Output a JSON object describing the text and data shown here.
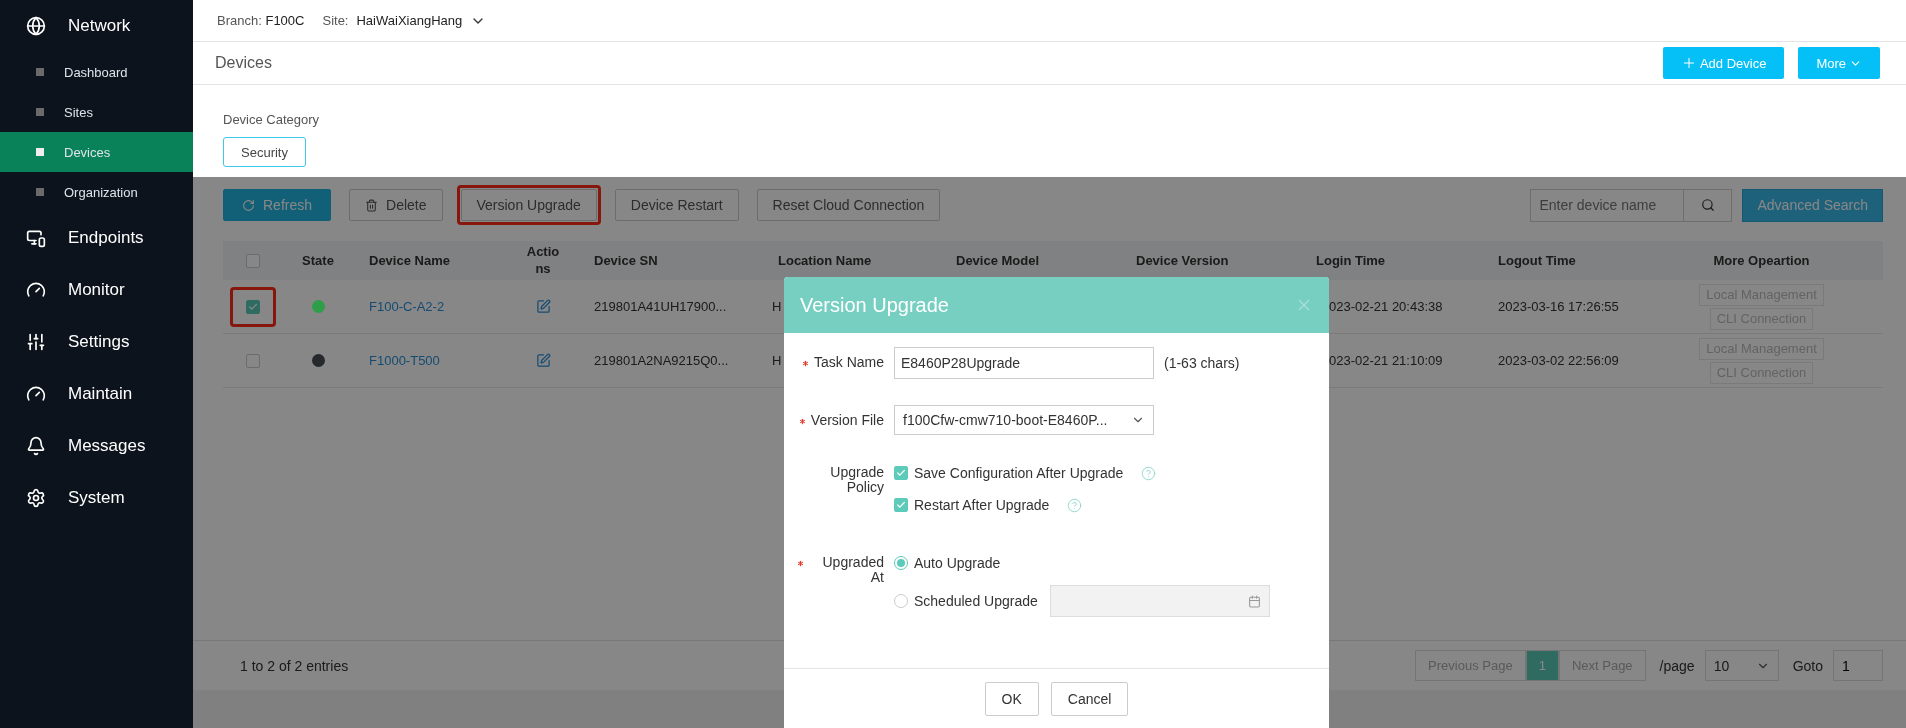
{
  "sidebar": {
    "items": [
      {
        "label": "Network",
        "kind": "network",
        "children": [
          {
            "label": "Dashboard",
            "selected": false
          },
          {
            "label": "Sites",
            "selected": false
          },
          {
            "label": "Devices",
            "selected": true
          },
          {
            "label": "Organization",
            "selected": false
          }
        ]
      },
      {
        "label": "Endpoints",
        "kind": "endpoints"
      },
      {
        "label": "Monitor",
        "kind": "gauge"
      },
      {
        "label": "Settings",
        "kind": "sliders"
      },
      {
        "label": "Maintain",
        "kind": "gauge"
      },
      {
        "label": "Messages",
        "kind": "bell"
      },
      {
        "label": "System",
        "kind": "gear"
      }
    ]
  },
  "top_bar": {
    "branch_label": "Branch:",
    "branch": "F100C",
    "site_label": "Site:",
    "site": "HaiWaiXiangHang"
  },
  "page": {
    "title": "Devices",
    "buttons": [
      {
        "label": "Add Device",
        "kind": "add"
      },
      {
        "label": "More",
        "kind": "menu"
      }
    ]
  },
  "category": {
    "label": "Device Category",
    "options": [
      {
        "label": "Security",
        "selected": true
      }
    ]
  },
  "toolbar": {
    "buttons": [
      {
        "label": "Refresh",
        "kind": "refresh",
        "highlighted": false
      },
      {
        "label": "Delete",
        "kind": "delete",
        "highlighted": false
      },
      {
        "label": "Version Upgrade",
        "kind": "plain",
        "highlighted": true
      },
      {
        "label": "Device Restart",
        "kind": "plain",
        "highlighted": false
      },
      {
        "label": "Reset Cloud Connection",
        "kind": "plain",
        "highlighted": false
      }
    ],
    "search": {
      "placeholder": "Enter device name"
    },
    "advanced": "Advanced Search"
  },
  "table": {
    "select_all": {
      "checked": false
    },
    "columns": [
      "State",
      "Device Name",
      "Actions",
      "Device SN",
      "Location Name",
      "Device Model",
      "Device Version",
      "Login Time",
      "Logout Time",
      "More Opeartion"
    ],
    "rows": [
      {
        "checked": true,
        "highlighted": true,
        "color": "#2e9e48",
        "name": "F100-C-A2-2",
        "sn": "219801A41UH17900...",
        "location": "H",
        "login": "023-02-21 20:43:38",
        "logout": "2023-03-16 17:26:55",
        "operations": [
          "Local Management",
          "CLI Connection"
        ]
      },
      {
        "checked": false,
        "highlighted": false,
        "color": "#25282c",
        "name": "F1000-T500",
        "sn": "219801A2NA9215Q0...",
        "location": "H",
        "login": "023-02-21 21:10:09",
        "logout": "2023-03-02 22:56:09",
        "operations": [
          "Local Management",
          "CLI Connection"
        ]
      }
    ]
  },
  "footer": {
    "summary": "1 to 2 of 2 entries",
    "prev": "Previous Page",
    "pages": [
      {
        "label": "1",
        "selected": true
      }
    ],
    "next": "Next Page",
    "per_page_label": "/page",
    "per_page": "10",
    "goto_label": "Goto",
    "goto": "1"
  },
  "dialog": {
    "title": "Version Upgrade",
    "fields": [
      {
        "kind": "text",
        "label": "Task Name",
        "required": true,
        "value": "E8460P28Upgrade",
        "hint": "(1-63 chars)"
      },
      {
        "kind": "select",
        "label": "Version File",
        "required": true,
        "value": "f100Cfw-cmw710-boot-E8460P..."
      },
      {
        "kind": "checks",
        "label": "Upgrade Policy",
        "required": false,
        "options": [
          {
            "label": "Save Configuration After Upgrade",
            "checked": true
          },
          {
            "label": "Restart After Upgrade",
            "checked": true
          }
        ]
      },
      {
        "kind": "radios",
        "label": "Upgraded At",
        "required": true,
        "options": [
          {
            "label": "Auto Upgrade",
            "selected": true,
            "date_field": false
          },
          {
            "label": "Scheduled Upgrade",
            "selected": false,
            "date_field": true
          }
        ]
      }
    ],
    "buttons": [
      "OK",
      "Cancel"
    ]
  }
}
